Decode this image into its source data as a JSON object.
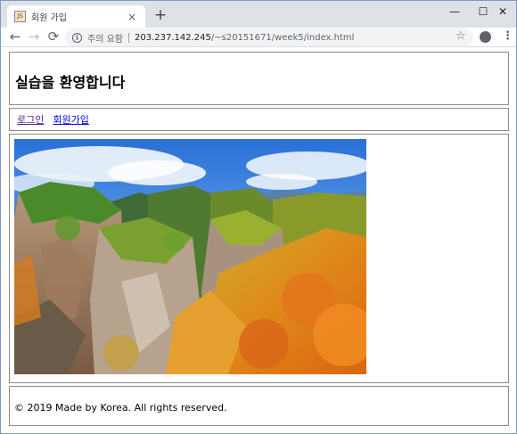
{
  "browser": {
    "tab_title": "회원 가입",
    "tab_close": "×",
    "new_tab": "+",
    "window_controls": {
      "minimize": "—",
      "maximize": "☐",
      "close": "✕"
    },
    "nav": {
      "back": "←",
      "forward": "→",
      "reload": "⟳"
    },
    "security_label": "주의 요함",
    "url_host": "203.237.142.245",
    "url_path": "/~s20151671/week5/index.html",
    "icons": [
      "info-icon",
      "star-icon",
      "account-icon",
      "menu-icon"
    ]
  },
  "page": {
    "heading": "실습을 환영합니다",
    "nav_links": [
      {
        "label": "로그인",
        "visited": true
      },
      {
        "label": "회원가입",
        "visited": false
      }
    ],
    "image_alt": "mountain landscape photo",
    "footer": "© 2019 Made by Korea. All rights reserved."
  },
  "colors": {
    "tabstrip": "#dee1e6",
    "visited_link": "#551a8b",
    "link": "#0000ee",
    "border": "#8c8c8c"
  }
}
